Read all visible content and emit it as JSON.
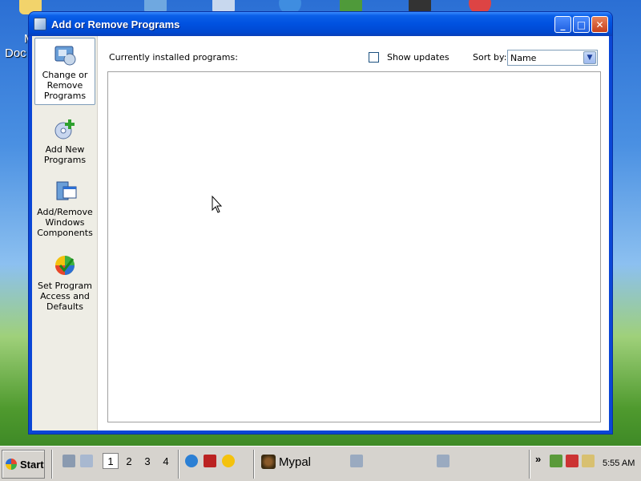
{
  "desktop": {
    "partial_labels": [
      "M",
      "Doc"
    ]
  },
  "window": {
    "title": "Add or Remove Programs",
    "controls": {
      "minimize": "_",
      "maximize": "□",
      "close": "✕"
    }
  },
  "sidebar": {
    "items": [
      {
        "label": "Change or Remove Programs",
        "selected": true
      },
      {
        "label": "Add New Programs",
        "selected": false
      },
      {
        "label": "Add/Remove Windows Components",
        "selected": false
      },
      {
        "label": "Set Program Access and Defaults",
        "selected": false
      }
    ]
  },
  "main": {
    "installed_label": "Currently installed programs:",
    "show_updates_label": "Show updates",
    "show_updates_checked": false,
    "sort_by_label": "Sort by:",
    "sort_by_value": "Name"
  },
  "taskbar": {
    "start_label": "Start",
    "workspaces": [
      "1",
      "2",
      "3",
      "4"
    ],
    "active_workspace": "1",
    "task_label": "Mypal",
    "overflow": "»",
    "clock": "5:55 AM"
  }
}
